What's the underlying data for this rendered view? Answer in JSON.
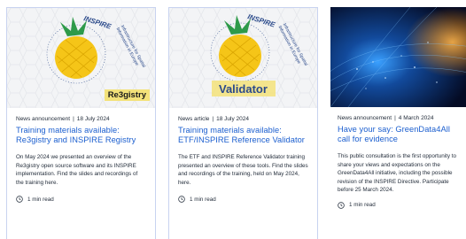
{
  "cards": [
    {
      "image_logo_text": "INSPIRE",
      "image_ring_text": "Infrastructure for Spatial Information in Europe",
      "image_badge": "Re3gistry",
      "type": "News announcement",
      "date": "18 July 2024",
      "title": "Training materials available: Re3gistry and INSPIRE Registry",
      "description": "On May 2024 we presented an overview of the Re3gistry open source software and its INSPIRE implementation. Find the slides and recordings of the training here.",
      "read_time": "1 min read"
    },
    {
      "image_logo_text": "INSPIRE",
      "image_ring_text": "Infrastructure for Spatial Information in Europe",
      "image_badge": "Validator",
      "type": "News article",
      "date": "18 July 2024",
      "title": "Training materials available: ETF/INSPIRE Reference Validator",
      "description": "The ETF and INSPIRE Reference Validator training presented an overview of these tools. Find the slides and recordings of the training, held on May 2024, here.",
      "read_time": "1 min read"
    },
    {
      "type": "News announcement",
      "date": "4 March 2024",
      "title": "Have your say: GreenData4All call for evidence",
      "description": "This public consultation is the first opportunity to share your views and expectations on the GreenData4All initiative, including the possible revision of the INSPIRE Directive. Participate before 25 March 2024.",
      "read_time": "1 min read"
    }
  ],
  "colors": {
    "accent_link": "#1c5fcf",
    "card_border": "#c8d3f0",
    "pineapple": "#f5c518",
    "leaf": "#2e9a4a",
    "badge_yellow": "#f3e27a"
  }
}
